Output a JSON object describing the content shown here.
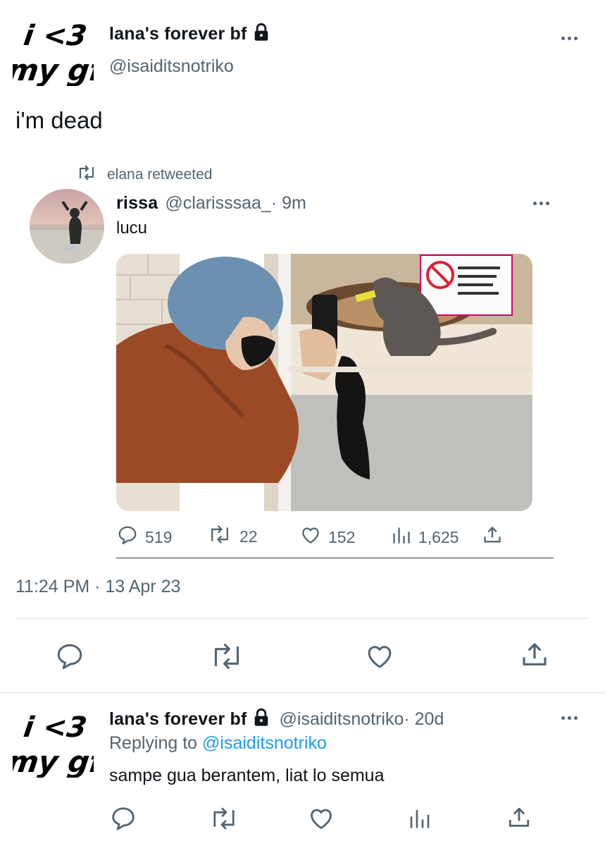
{
  "main_tweet": {
    "avatar_text": [
      "i <3",
      "my gf"
    ],
    "display_name": "lana's forever bf",
    "handle": "@isaiditsnotriko",
    "text": "i'm dead",
    "timestamp": "11:24 PM · 13 Apr 23"
  },
  "quoted": {
    "retweet_note": "elana retweeted",
    "display_name": "rissa",
    "handle": "@clarisssaa_",
    "time": " · 9m",
    "text": "lucu",
    "stats": {
      "replies": "519",
      "retweets": "22",
      "likes": "152",
      "views": "1,625"
    }
  },
  "reply_tweet": {
    "avatar_text": [
      "i <3",
      "my gf"
    ],
    "display_name": "lana's forever bf",
    "handle": "@isaiditsnotriko",
    "time": " · 20d",
    "replying_prefix": "Replying to ",
    "replying_handle": "@isaiditsnotriko",
    "text": "sampe gua berantem, liat lo semua"
  },
  "icons": {
    "reply": "reply-icon",
    "retweet": "retweet-icon",
    "like": "heart-icon",
    "views": "views-icon",
    "share": "share-icon",
    "lock": "lock-icon",
    "more": "more-icon"
  },
  "colors": {
    "text": "#0f1419",
    "muted": "#536471",
    "link": "#1d9bf0",
    "divider": "#dfe3e6"
  }
}
